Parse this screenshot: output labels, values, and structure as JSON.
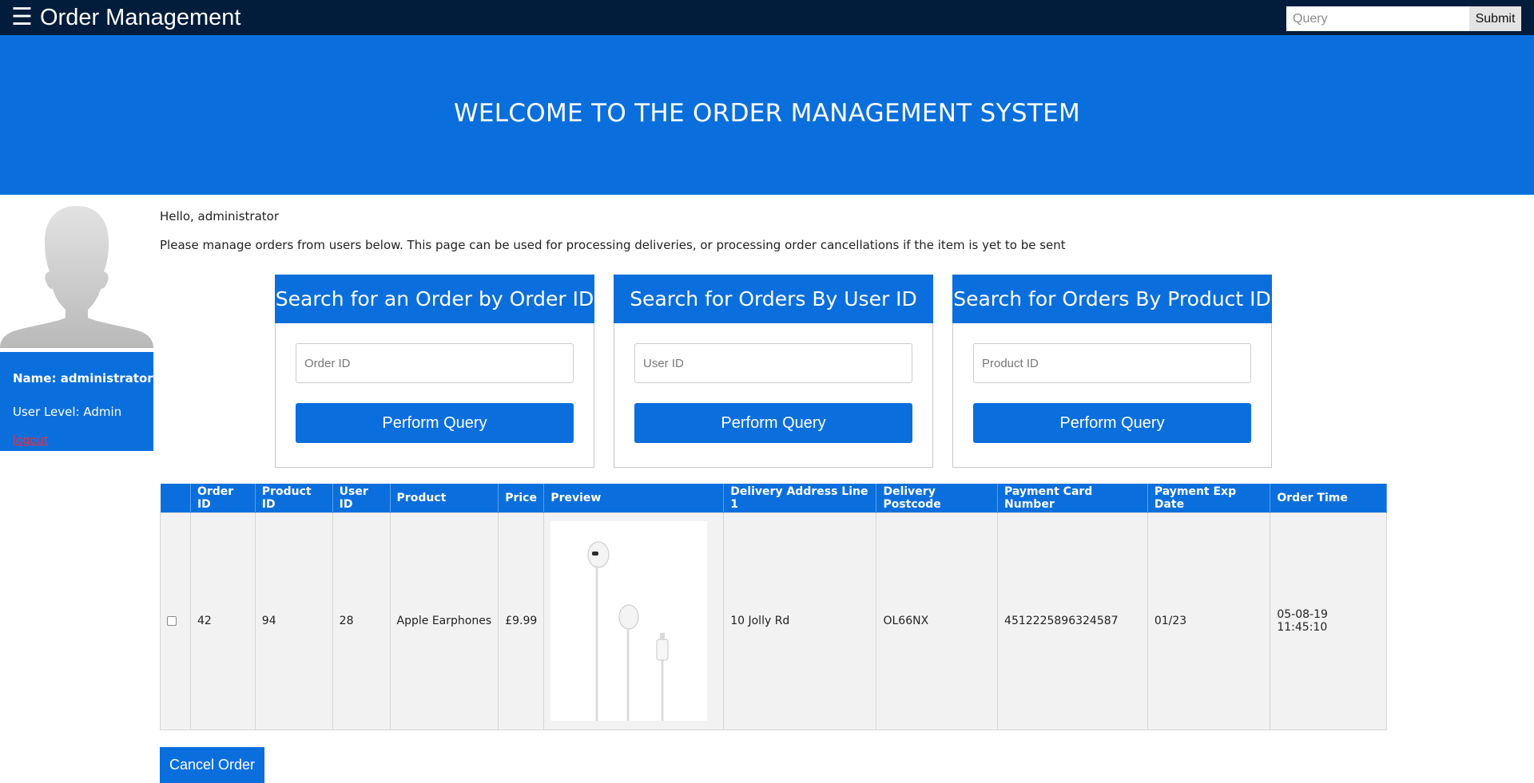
{
  "header": {
    "menu_icon": "☰",
    "title": "Order Management",
    "search_placeholder": "Query",
    "submit_label": "Submit"
  },
  "banner": {
    "heading": "WELCOME TO THE ORDER MANAGEMENT SYSTEM"
  },
  "sidebar": {
    "name": "Name: administrator",
    "level": "User Level: Admin",
    "logout": "logout"
  },
  "main": {
    "greeting": "Hello, administrator",
    "intro": "Please manage orders from users below. This page can be used for processing deliveries, or processing order cancellations if the item is yet to be sent"
  },
  "search_cards": [
    {
      "title": "Search for an Order by Order ID",
      "placeholder": "Order ID",
      "button": "Perform Query"
    },
    {
      "title": "Search for Orders By User ID",
      "placeholder": "User ID",
      "button": "Perform Query"
    },
    {
      "title": "Search for Orders By Product ID",
      "placeholder": "Product ID",
      "button": "Perform Query"
    }
  ],
  "table": {
    "headers": [
      "",
      "Order ID",
      "Product ID",
      "User ID",
      "Product",
      "Price",
      "Preview",
      "Delivery Address Line 1",
      "Delivery Postcode",
      "Payment Card Number",
      "Payment Exp Date",
      "Order Time"
    ],
    "rows": [
      {
        "checked": false,
        "order_id": "42",
        "product_id": "94",
        "user_id": "28",
        "product": "Apple Earphones",
        "price": "£9.99",
        "preview_icon": "earphones-image",
        "address": "10 Jolly Rd",
        "postcode": "OL66NX",
        "card_number": "4512225896324587",
        "exp_date": "01/23",
        "order_time": "05-08-19 11:45:10"
      }
    ]
  },
  "actions": {
    "cancel_label": "Cancel Order"
  },
  "colors": {
    "topbar": "#021c3b",
    "primary": "#0a6fdc",
    "logout": "#ff2b2b",
    "row_bg": "#f2f2f2"
  }
}
